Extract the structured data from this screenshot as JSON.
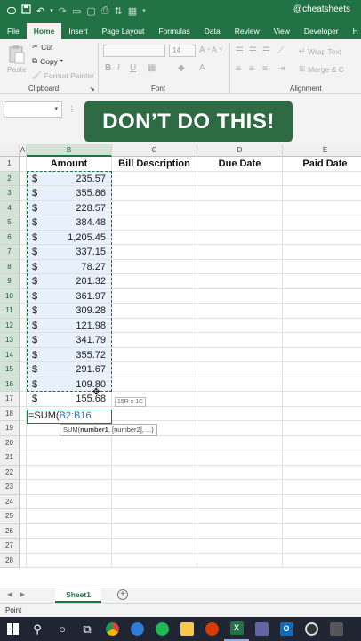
{
  "titlebar": {
    "handle": "@cheatsheets"
  },
  "tabs": [
    "File",
    "Home",
    "Insert",
    "Page Layout",
    "Formulas",
    "Data",
    "Review",
    "View",
    "Developer",
    "H"
  ],
  "ribbon": {
    "cut": "Cut",
    "copy": "Copy",
    "paste": "Paste",
    "format_painter": "Format Painter",
    "clipboard_label": "Clipboard",
    "font_size": "14",
    "font_label": "Font",
    "wrap_text": "Wrap Text",
    "merge": "Merge & C",
    "alignment_label": "Alignment"
  },
  "banner": "DON’T DO THIS!",
  "columns": [
    "A",
    "B",
    "C",
    "D",
    "E"
  ],
  "headers": {
    "amount": "Amount",
    "bill_description": "Bill Description",
    "due_date": "Due Date",
    "paid_date": "Paid Date"
  },
  "rows": [
    "1",
    "2",
    "3",
    "4",
    "5",
    "6",
    "7",
    "8",
    "9",
    "10",
    "11",
    "12",
    "13",
    "14",
    "15",
    "16",
    "17",
    "18",
    "19",
    "20",
    "21",
    "22",
    "23",
    "24",
    "25",
    "26",
    "27",
    "28"
  ],
  "currency": "$",
  "amounts": [
    "235.57",
    "355.86",
    "228.57",
    "384.48",
    "1,205.45",
    "337.15",
    "78.27",
    "201.32",
    "361.97",
    "309.28",
    "121.98",
    "341.79",
    "355.72",
    "291.67",
    "109.80",
    "155.68"
  ],
  "editing": {
    "prefix": "=SUM(",
    "ref": "B2:B16"
  },
  "size_tooltip": "15R x 1C",
  "arg_hint": {
    "fn": "SUM(",
    "arg1": "number1",
    "rest": ", [number2], ...)"
  },
  "sheet_tab": "Sheet1",
  "status": "Point",
  "colors": {
    "excel_green": "#217346",
    "banner": "#2e6b44",
    "selection_fill": "#e8f0fb"
  }
}
